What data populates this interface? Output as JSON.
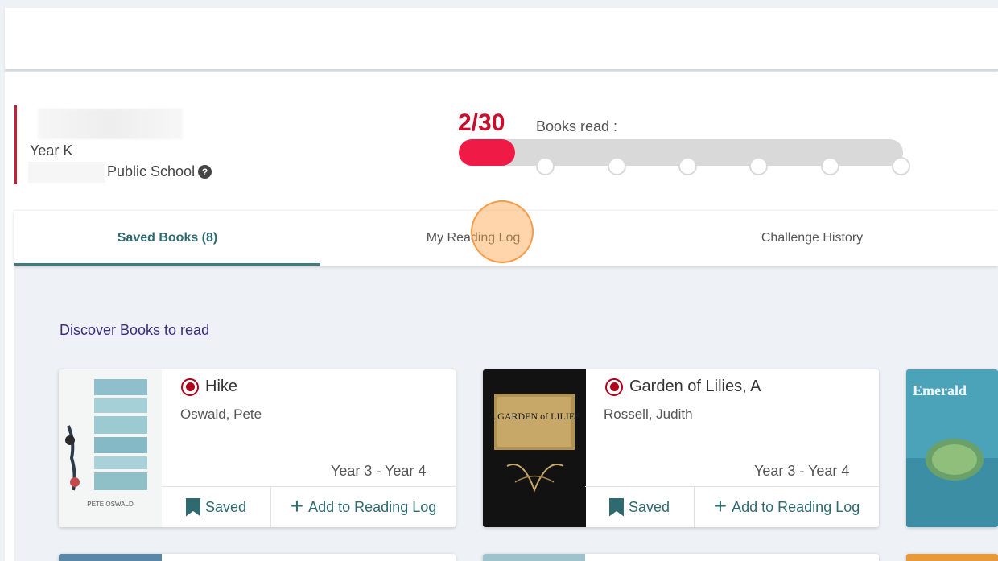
{
  "student": {
    "year": "Year K",
    "school": "Public School"
  },
  "progress": {
    "count": "2/30",
    "label": "Books read :",
    "read": 2,
    "total": 30
  },
  "tabs": [
    {
      "label": "Saved Books (8)",
      "active": true
    },
    {
      "label": "My Reading Log",
      "active": false
    },
    {
      "label": "Challenge History",
      "active": false
    }
  ],
  "discover_link": "Discover Books to read",
  "books": [
    {
      "title": "Hike",
      "author": "Oswald, Pete",
      "grade": "Year 3 - Year 4",
      "saved_label": "Saved",
      "add_label": "Add to Reading Log",
      "cover_text": "PETE OSWALD"
    },
    {
      "title": "Garden of Lilies, A",
      "author": "Rossell, Judith",
      "grade": "Year 3 - Year 4",
      "saved_label": "Saved",
      "add_label": "Add to Reading Log",
      "cover_text": "A GARDEN of LILIES"
    },
    {
      "title": "",
      "cover_text": "Emerald"
    }
  ],
  "colors": {
    "accent": "#2e6a70",
    "brand_red": "#c8102e",
    "progress_fill": "#ef1a45",
    "track": "#d9d9d9"
  },
  "icons": {
    "help": "question-circle-icon",
    "saved": "bookmark-icon",
    "add": "plus-icon",
    "selected": "radio-selected-icon"
  }
}
